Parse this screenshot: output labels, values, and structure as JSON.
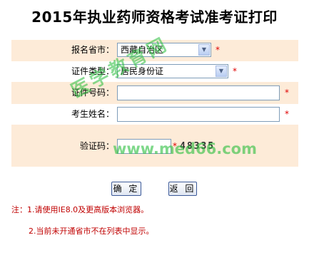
{
  "page": {
    "title": "2015年执业药师资格考试准考证打印"
  },
  "form": {
    "province": {
      "label": "报名省市：",
      "value": "西藏自治区"
    },
    "id_type": {
      "label": "证件类型：",
      "value": "居民身份证"
    },
    "id_number": {
      "label": "证件号码：",
      "value": ""
    },
    "name": {
      "label": "考生姓名：",
      "value": ""
    },
    "captcha": {
      "label": "验证码：",
      "value": "",
      "code": "48335"
    },
    "required_mark": "*"
  },
  "buttons": {
    "confirm": "确 定",
    "back": "返 回"
  },
  "notes": {
    "line1": "注：1.请使用IE8.0及更高版本浏览器。",
    "line2": "2.当前未开通省市不在列表中显示。"
  },
  "watermark": {
    "text_cn": "医学教育网",
    "url": "www.med66.com"
  }
}
